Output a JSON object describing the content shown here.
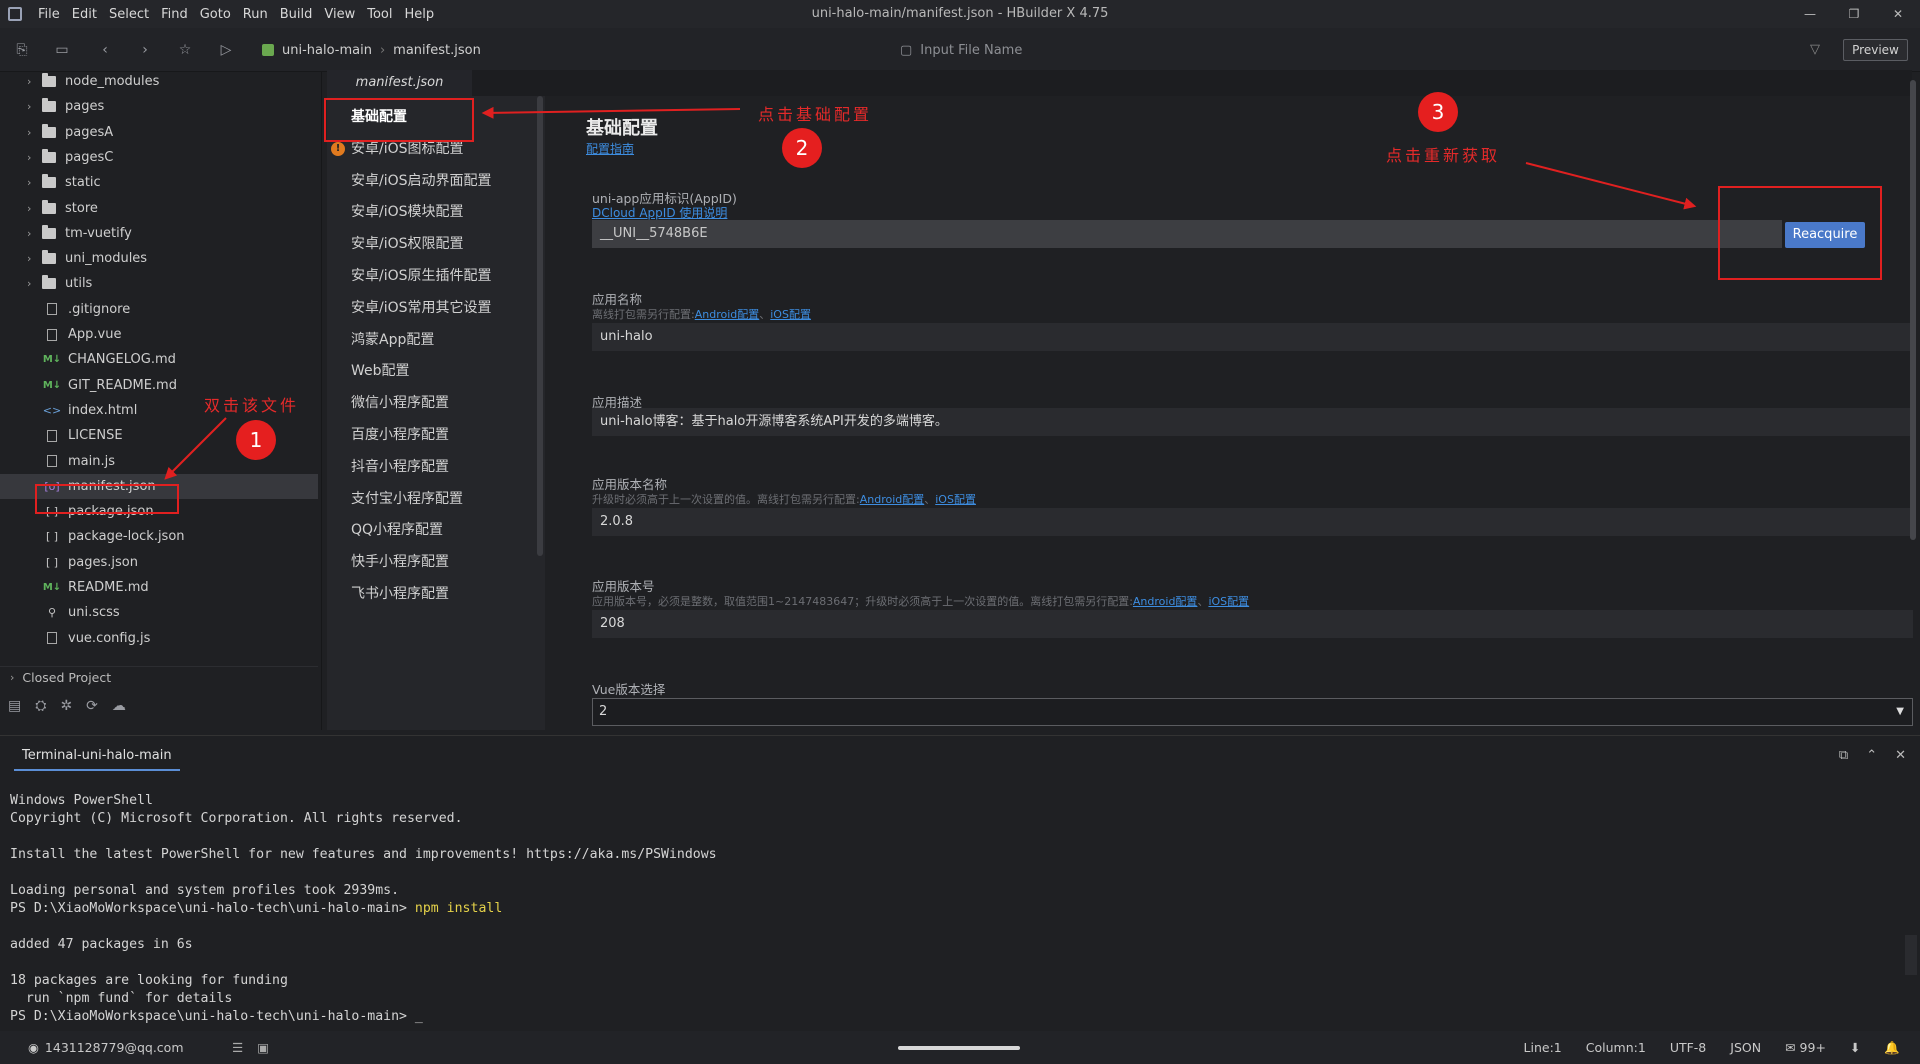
{
  "window": {
    "title": "uni-halo-main/manifest.json - HBuilder X 4.75",
    "menu": [
      "File",
      "Edit",
      "Select",
      "Find",
      "Goto",
      "Run",
      "Build",
      "View",
      "Tool",
      "Help"
    ]
  },
  "toolbar": {
    "breadcrumb": [
      "uni-halo-main",
      "manifest.json"
    ],
    "input_file_placeholder": "Input File Name",
    "preview_label": "Preview"
  },
  "sidebar": {
    "items": [
      {
        "type": "folder",
        "label": "node_modules"
      },
      {
        "type": "folder",
        "label": "pages"
      },
      {
        "type": "folder",
        "label": "pagesA"
      },
      {
        "type": "folder",
        "label": "pagesC"
      },
      {
        "type": "folder",
        "label": "static"
      },
      {
        "type": "folder",
        "label": "store"
      },
      {
        "type": "folder",
        "label": "tm-vuetify"
      },
      {
        "type": "folder",
        "label": "uni_modules"
      },
      {
        "type": "folder",
        "label": "utils"
      },
      {
        "type": "file",
        "icon": "doc",
        "label": ".gitignore"
      },
      {
        "type": "file",
        "icon": "doc",
        "label": "App.vue"
      },
      {
        "type": "file",
        "icon": "md",
        "label": "CHANGELOG.md"
      },
      {
        "type": "file",
        "icon": "md",
        "label": "GIT_README.md"
      },
      {
        "type": "file",
        "icon": "html",
        "label": "index.html"
      },
      {
        "type": "file",
        "icon": "doc",
        "label": "LICENSE"
      },
      {
        "type": "file",
        "icon": "doc",
        "label": "main.js"
      },
      {
        "type": "file",
        "icon": "manifest",
        "label": "manifest.json"
      },
      {
        "type": "file",
        "icon": "json",
        "label": "package.json"
      },
      {
        "type": "file",
        "icon": "json",
        "label": "package-lock.json"
      },
      {
        "type": "file",
        "icon": "json",
        "label": "pages.json"
      },
      {
        "type": "file",
        "icon": "md",
        "label": "README.md"
      },
      {
        "type": "file",
        "icon": "link",
        "label": "uni.scss"
      },
      {
        "type": "file",
        "icon": "doc",
        "label": "vue.config.js"
      }
    ],
    "closed_project": "Closed Project"
  },
  "editor": {
    "tab": "manifest.json"
  },
  "config_nav": [
    "基础配置",
    "安卓/iOS图标配置",
    "安卓/iOS启动界面配置",
    "安卓/iOS模块配置",
    "安卓/iOS权限配置",
    "安卓/iOS原生插件配置",
    "安卓/iOS常用其它设置",
    "鸿蒙App配置",
    "Web配置",
    "微信小程序配置",
    "百度小程序配置",
    "抖音小程序配置",
    "支付宝小程序配置",
    "QQ小程序配置",
    "快手小程序配置",
    "飞书小程序配置"
  ],
  "config": {
    "title": "基础配置",
    "guide_link": "配置指南",
    "appid": {
      "label": "uni-app应用标识(AppID)",
      "link": "DCloud AppID 使用说明",
      "value": "__UNI__5748B6E",
      "button": "Reacquire"
    },
    "app_name": {
      "label": "应用名称",
      "hint": "离线打包需另行配置:",
      "link_android": "Android配置",
      "link_ios": "iOS配置",
      "value": "uni-halo"
    },
    "app_desc": {
      "label": "应用描述",
      "value": "uni-halo博客：基于halo开源博客系统API开发的多端博客。"
    },
    "version_name": {
      "label": "应用版本名称",
      "hint": "升级时必须高于上一次设置的值。离线打包需另行配置:",
      "link_android": "Android配置",
      "link_ios": "iOS配置",
      "value": "2.0.8"
    },
    "version_code": {
      "label": "应用版本号",
      "hint": "应用版本号，必须是整数，取值范围1~2147483647；升级时必须高于上一次设置的值。离线打包需另行配置:",
      "link_android": "Android配置",
      "link_ios": "iOS配置",
      "value": "208"
    },
    "vue_version": {
      "label": "Vue版本选择",
      "value": "2"
    }
  },
  "annotations": {
    "step1_text": "双击该文件",
    "step1_num": "1",
    "step2_text": "点击基础配置",
    "step2_num": "2",
    "step3_text": "点击重新获取",
    "step3_num": "3"
  },
  "terminal": {
    "tab": "Terminal-uni-halo-main",
    "lines": [
      {
        "text": "Windows PowerShell"
      },
      {
        "text": "Copyright (C) Microsoft Corporation. All rights reserved."
      },
      {
        "text": ""
      },
      {
        "text": "Install the latest PowerShell for new features and improvements! https://aka.ms/PSWindows"
      },
      {
        "text": ""
      },
      {
        "text": "Loading personal and system profiles took 2939ms."
      },
      {
        "prompt": "PS D:\\XiaoMoWorkspace\\uni-halo-tech\\uni-halo-main> ",
        "cmd": "npm install"
      },
      {
        "text": ""
      },
      {
        "text": "added 47 packages in 6s"
      },
      {
        "text": ""
      },
      {
        "text": "18 packages are looking for funding"
      },
      {
        "text": "  run `npm fund` for details"
      },
      {
        "prompt": "PS D:\\XiaoMoWorkspace\\uni-halo-tech\\uni-halo-main> ",
        "cmd": "_"
      }
    ]
  },
  "statusbar": {
    "user": "1431128779@qq.com",
    "line": "Line:1",
    "column": "Column:1",
    "encoding": "UTF-8",
    "language": "JSON",
    "notifications": "99+"
  }
}
